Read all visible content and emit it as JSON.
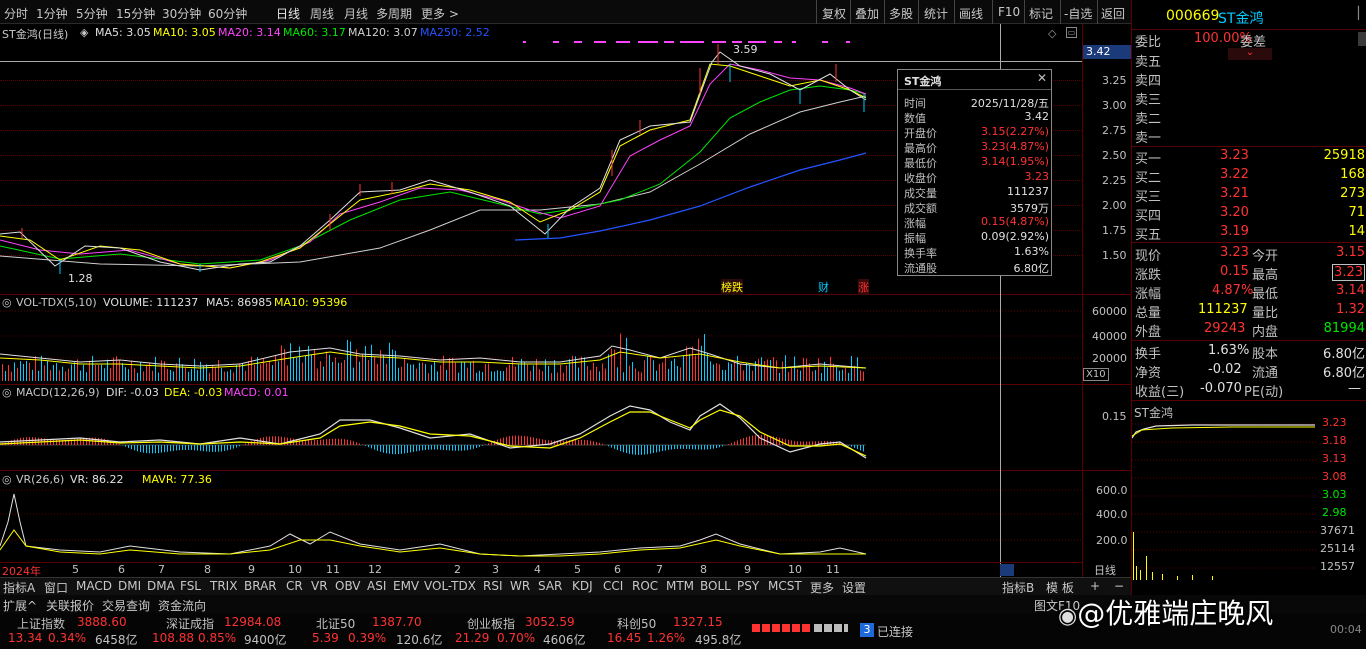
{
  "toolbar": {
    "periods": [
      "分时",
      "1分钟",
      "5分钟",
      "15分钟",
      "30分钟",
      "60分钟",
      "日线",
      "周线",
      "月线",
      "多周期",
      "更多 >"
    ],
    "right": [
      "复权",
      "叠加",
      "多股",
      "统计",
      "画线",
      "F10",
      "标记",
      "-自选",
      "返回"
    ]
  },
  "main_chart": {
    "title": "ST金鸿(日线)",
    "ma5": "MA5: 3.05",
    "ma10": "MA10: 3.05",
    "ma20": "MA20: 3.14",
    "ma60": "MA60: 3.17",
    "ma120": "MA120: 3.07",
    "ma250": "MA250: 2.52",
    "high_label": "3.59",
    "low_label": "1.28",
    "price_tag": "3.42",
    "y_ticks": [
      "3.25",
      "3.00",
      "2.75",
      "2.50",
      "2.25",
      "2.00",
      "1.75",
      "1.50"
    ],
    "events": [
      "榜跌",
      "财",
      "涨"
    ],
    "colors": {
      "ma5": "#e0e0e0",
      "ma10": "#ffff00",
      "ma20": "#ff44ff",
      "ma60": "#00e600",
      "ma120": "#d0d0d0",
      "ma250": "#2255ff"
    }
  },
  "vol_panel": {
    "title": "VOL-TDX(5,10)",
    "volume": "VOLUME: 111237",
    "ma5": "MA5: 86985",
    "ma10": "MA10: 95396",
    "y_ticks": [
      "60000",
      "40000",
      "20000"
    ],
    "unit": "X10"
  },
  "macd_panel": {
    "title": "MACD(12,26,9)",
    "dif": "DIF: -0.03",
    "dea": "DEA: -0.03",
    "macd": "MACD: 0.01",
    "y_ticks": [
      "0.15"
    ]
  },
  "vr_panel": {
    "title": "VR(26,6)",
    "vr": "VR: 86.22",
    "mavr": "MAVR: 77.36",
    "y_ticks": [
      "600.0",
      "400.0",
      "200.0"
    ],
    "period": "日线"
  },
  "x_axis": {
    "start": "2024年",
    "months": [
      "5",
      "6",
      "7",
      "8",
      "9",
      "10",
      "11",
      "12",
      "2",
      "3",
      "4",
      "5",
      "6",
      "7",
      "8",
      "9",
      "10",
      "11"
    ]
  },
  "tooltip": {
    "title": "ST金鸿",
    "rows": [
      {
        "k": "时间",
        "v": "2025/11/28/五"
      },
      {
        "k": "数值",
        "v": "3.42"
      },
      {
        "k": "开盘价",
        "v": "3.15(2.27%)"
      },
      {
        "k": "最高价",
        "v": "3.23(4.87%)"
      },
      {
        "k": "最低价",
        "v": "3.14(1.95%)"
      },
      {
        "k": "收盘价",
        "v": "3.23"
      },
      {
        "k": "成交量",
        "v": "111237"
      },
      {
        "k": "成交额",
        "v": "3579万"
      },
      {
        "k": "涨幅",
        "v": "0.15(4.87%)"
      },
      {
        "k": "振幅",
        "v": "0.09(2.92%)"
      },
      {
        "k": "换手率",
        "v": "1.63%"
      },
      {
        "k": "流通股",
        "v": "6.80亿"
      }
    ]
  },
  "quote": {
    "code": "000669",
    "name": "ST金鸿",
    "wei_bi_label": "委比",
    "wei_bi": "100.00%",
    "wei_cha_label": "委差",
    "sells": [
      "卖五",
      "卖四",
      "卖三",
      "卖二",
      "卖一"
    ],
    "buys": [
      {
        "l": "买一",
        "p": "3.23",
        "v": "25918"
      },
      {
        "l": "买二",
        "p": "3.22",
        "v": "168"
      },
      {
        "l": "买三",
        "p": "3.21",
        "v": "273"
      },
      {
        "l": "买四",
        "p": "3.20",
        "v": "71"
      },
      {
        "l": "买五",
        "p": "3.19",
        "v": "14"
      }
    ],
    "stats": [
      {
        "l1": "现价",
        "v1": "3.23",
        "l2": "今开",
        "v2": "3.15"
      },
      {
        "l1": "涨跌",
        "v1": "0.15",
        "l2": "最高",
        "v2": "3.23"
      },
      {
        "l1": "涨幅",
        "v1": "4.87%",
        "l2": "最低",
        "v2": "3.14"
      },
      {
        "l1": "总量",
        "v1": "111237",
        "l2": "量比",
        "v2": "1.32"
      },
      {
        "l1": "外盘",
        "v1": "29243",
        "l2": "内盘",
        "v2": "81994"
      }
    ],
    "stats2": [
      {
        "l1": "换手",
        "v1": "1.63%",
        "l2": "股本",
        "v2": "6.80亿"
      },
      {
        "l1": "净资",
        "v1": "-0.02",
        "l2": "流通",
        "v2": "6.80亿"
      },
      {
        "l1": "收益(三)",
        "v1": "-0.070",
        "l2": "PE(动)",
        "v2": "—"
      }
    ],
    "mini_title": "ST金鸿",
    "mini_prices": [
      "3.23",
      "3.18",
      "3.13",
      "3.08",
      "3.03",
      "2.98"
    ],
    "mini_vols": [
      "37671",
      "25114",
      "12557"
    ]
  },
  "tabs": [
    "指标A",
    "窗口",
    "MACD",
    "DMI",
    "DMA",
    "FSL",
    "TRIX",
    "BRAR",
    "CR",
    "VR",
    "OBV",
    "ASI",
    "EMV",
    "VOL-TDX",
    "RSI",
    "WR",
    "SAR",
    "KDJ",
    "CCI",
    "ROC",
    "MTM",
    "BOLL",
    "PSY",
    "MCST",
    "更多",
    "设置"
  ],
  "tabs_right": [
    "指标B",
    "模 板",
    "+",
    "−"
  ],
  "bottom_links": [
    "扩展^",
    "关联报价",
    "交易查询",
    "资金流向"
  ],
  "indices": [
    {
      "name": "上证指数",
      "val": "3888.60",
      "chg": "13.34",
      "pct": "0.34%",
      "amt": "6458亿"
    },
    {
      "name": "深证成指",
      "val": "12984.08",
      "chg": "108.88",
      "pct": "0.85%",
      "amt": "9400亿"
    },
    {
      "name": "北证50",
      "val": "1387.70",
      "chg": "5.39",
      "pct": "0.39%",
      "amt": "120.6亿"
    },
    {
      "name": "创业板指",
      "val": "3052.59",
      "chg": "21.29",
      "pct": "0.70%",
      "amt": "4606亿"
    },
    {
      "name": "科创50",
      "val": "1327.15",
      "chg": "16.45",
      "pct": "1.26%",
      "amt": "495.8亿"
    }
  ],
  "status": {
    "conn_num": "3",
    "conn_text": "已连接",
    "time": "00:04"
  },
  "watermark": "@优雅端庄晚风",
  "bottom_right": "图文F10"
}
